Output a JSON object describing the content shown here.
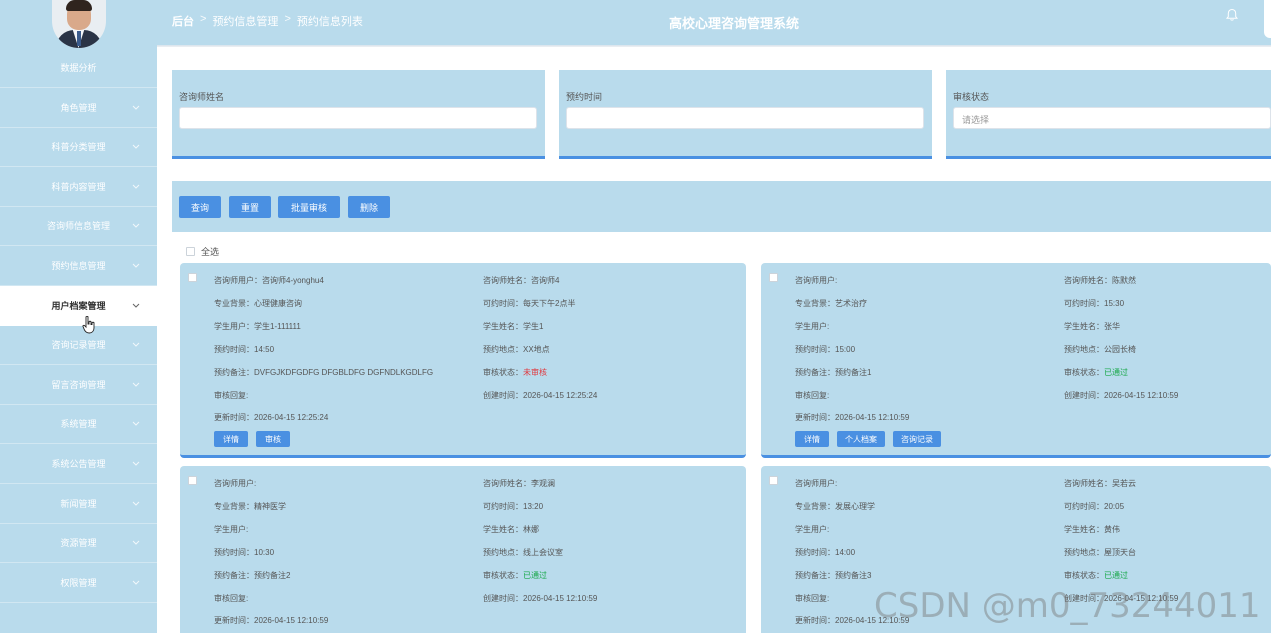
{
  "header": {
    "breadcrumb": [
      "后台",
      "预约信息管理",
      "预约信息列表"
    ],
    "breadcrumb_sep": ">",
    "title": "高校心理咨询管理系统"
  },
  "sidebar": {
    "items": [
      {
        "label": "数据分析",
        "chevron": false
      },
      {
        "label": "角色管理",
        "chevron": true
      },
      {
        "label": "科普分类管理",
        "chevron": true
      },
      {
        "label": "科普内容管理",
        "chevron": true
      },
      {
        "label": "咨询师信息管理",
        "chevron": true
      },
      {
        "label": "预约信息管理",
        "chevron": true
      },
      {
        "label": "用户档案管理",
        "chevron": true,
        "active": true
      },
      {
        "label": "咨询记录管理",
        "chevron": true
      },
      {
        "label": "留言咨询管理",
        "chevron": true
      },
      {
        "label": "系统管理",
        "chevron": true
      },
      {
        "label": "系统公告管理",
        "chevron": true
      },
      {
        "label": "新闻管理",
        "chevron": true
      },
      {
        "label": "资源管理",
        "chevron": true
      },
      {
        "label": "权限管理",
        "chevron": true
      }
    ]
  },
  "filters": {
    "counselor_name": {
      "label": "咨询师姓名",
      "value": ""
    },
    "appointment_time": {
      "label": "预约时间",
      "value": ""
    },
    "review_status": {
      "label": "审核状态",
      "placeholder": "请选择"
    }
  },
  "buttons": {
    "query": "查询",
    "reset": "重置",
    "batch_review": "批量审核",
    "delete": "删除"
  },
  "select_all": "全选",
  "cards": [
    {
      "left": [
        "咨询师用户：咨询师4-yonghu4",
        "专业背景：心理健康咨询",
        "学生用户：学生1-111111",
        "预约时间：14:50",
        "预约备注：DVFGJKDFGDFG DFGBLDFG DGFNDLKGDLFG",
        "审核回复:",
        "更新时间：2026-04-15 12:25:24"
      ],
      "right": [
        "咨询师姓名：咨询师4",
        "可约时间：每天下午2点半",
        "学生姓名：学生1",
        "预约地点：XX地点",
        {
          "label": "审核状态：",
          "value": "未审核",
          "tone": "red"
        },
        "创建时间：2026-04-15 12:25:24"
      ],
      "actions": [
        "详情",
        "审核"
      ]
    },
    {
      "left": [
        "咨询师用户:",
        "专业背景：艺术治疗",
        "学生用户:",
        "预约时间：15:00",
        "预约备注：预约备注1",
        "审核回复:",
        "更新时间：2026-04-15 12:10:59"
      ],
      "right": [
        "咨询师姓名：陈默然",
        "可约时间：15:30",
        "学生姓名：张华",
        "预约地点：公园长椅",
        {
          "label": "审核状态：",
          "value": "已通过",
          "tone": "green"
        },
        "创建时间：2026-04-15 12:10:59"
      ],
      "actions": [
        "详情",
        "个人档案",
        "咨询记录"
      ]
    },
    {
      "left": [
        "咨询师用户:",
        "专业背景：精神医学",
        "学生用户:",
        "预约时间：10:30",
        "预约备注：预约备注2",
        "审核回复:",
        "更新时间：2026-04-15 12:10:59"
      ],
      "right": [
        "咨询师姓名：李观澜",
        "可约时间：13:20",
        "学生姓名：林娜",
        "预约地点：线上会议室",
        {
          "label": "审核状态：",
          "value": "已通过",
          "tone": "green"
        },
        "创建时间：2026-04-15 12:10:59"
      ],
      "actions": []
    },
    {
      "left": [
        "咨询师用户:",
        "专业背景：发展心理学",
        "学生用户:",
        "预约时间：14:00",
        "预约备注：预约备注3",
        "审核回复:",
        "更新时间：2026-04-15 12:10:59"
      ],
      "right": [
        "咨询师姓名：吴若云",
        "可约时间：20:05",
        "学生姓名：黄伟",
        "预约地点：屋顶天台",
        {
          "label": "审核状态：",
          "value": "已通过",
          "tone": "green"
        },
        "创建时间：2026-04-15 12:10:59"
      ],
      "actions": []
    }
  ],
  "watermark": "CSDN @m0_73244011",
  "colors": {
    "panel": "#b9dbec",
    "accent": "#4a90e2",
    "status_pending": "#e0383e",
    "status_approved": "#19a84a"
  }
}
